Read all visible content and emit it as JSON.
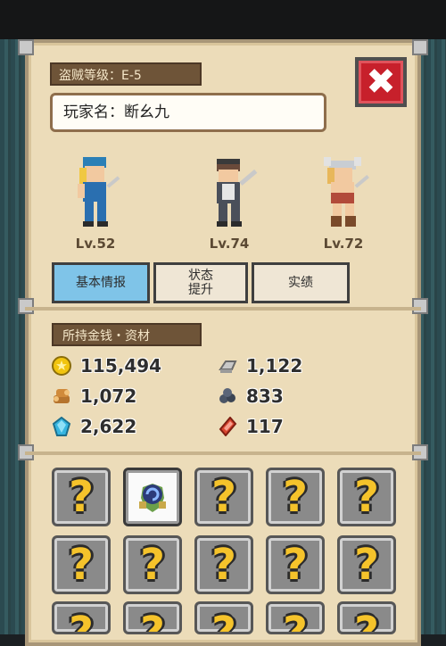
{
  "rank_label": "盗贼等级：E-5",
  "player_name": "玩家名：断幺九",
  "close_label": "✖",
  "characters": [
    {
      "level": "Lv.52",
      "hair": "#2b7fb6",
      "body": "#2a6fb0"
    },
    {
      "level": "Lv.74",
      "hair": "#6a4a3a",
      "body": "#4a4f5a"
    },
    {
      "level": "Lv.72",
      "hair": "#c8cdd3",
      "body": "#b24a3a"
    }
  ],
  "tabs": [
    {
      "label": "基本情报",
      "active": true
    },
    {
      "label": "状态\n提升",
      "active": false
    },
    {
      "label": "实绩",
      "active": false
    }
  ],
  "money_label": "所持金钱・资材",
  "resources_left": [
    {
      "icon": "gold-coin-icon",
      "value": "115,494"
    },
    {
      "icon": "wood-log-icon",
      "value": "1,072"
    },
    {
      "icon": "blue-gem-icon",
      "value": "2,622"
    }
  ],
  "resources_right": [
    {
      "icon": "iron-ingot-icon",
      "value": "1,122"
    },
    {
      "icon": "ore-icon",
      "value": "833"
    },
    {
      "icon": "red-crystal-icon",
      "value": "117"
    }
  ],
  "slot_question": "?",
  "colors": {
    "accent_tab": "#7fc4e8",
    "close": "#c7202b",
    "panel": "#ecdcb9"
  }
}
